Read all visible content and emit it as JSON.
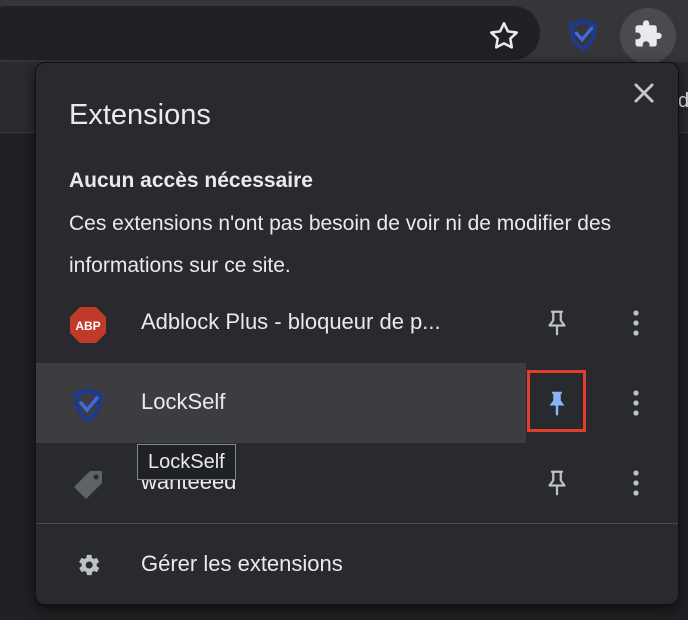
{
  "toolbar": {
    "star_icon": "star-outline-icon",
    "pinned_extension_icon": "lockself-shield-icon",
    "extensions_icon": "puzzle-icon",
    "page_edge_text": "d"
  },
  "popup": {
    "title": "Extensions",
    "close_icon": "close-icon",
    "section": {
      "title": "Aucun accès nécessaire",
      "description": "Ces extensions n'ont pas besoin de voir ni de modifier des informations sur ce site."
    },
    "extensions": [
      {
        "name": "Adblock Plus - bloqueur de p...",
        "icon": "abp-icon",
        "icon_text": "ABP",
        "pinned": false
      },
      {
        "name": "LockSelf",
        "icon": "lockself-shield-icon",
        "pinned": true
      },
      {
        "name": "wanteeed",
        "icon": "tag-icon",
        "pinned": false
      }
    ],
    "tooltip": "LockSelf",
    "manage": {
      "label": "Gérer les extensions",
      "icon": "gear-icon"
    }
  },
  "colors": {
    "pin_active": "#8ab4f8",
    "highlight_border": "#e0402b",
    "abp_red": "#c0392b"
  }
}
